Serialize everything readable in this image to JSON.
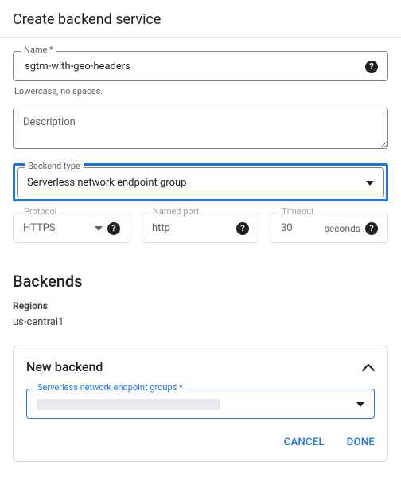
{
  "title": "Create backend service",
  "name": {
    "label": "Name *",
    "value": "sgtm-with-geo-headers",
    "helper": "Lowercase, no spaces."
  },
  "description": {
    "placeholder": "Description"
  },
  "backend_type": {
    "label": "Backend type",
    "value": "Serverless network endpoint group"
  },
  "protocol": {
    "label": "Protocol",
    "value": "HTTPS"
  },
  "named_port": {
    "label": "Named port",
    "value": "http"
  },
  "timeout": {
    "label": "Timeout",
    "value": "30",
    "unit": "seconds"
  },
  "backends": {
    "heading": "Backends",
    "regions_label": "Regions",
    "region_value": "us-central1"
  },
  "new_backend": {
    "title": "New backend",
    "neg_label": "Serverless network endpoint groups *",
    "cancel": "CANCEL",
    "done": "DONE"
  }
}
